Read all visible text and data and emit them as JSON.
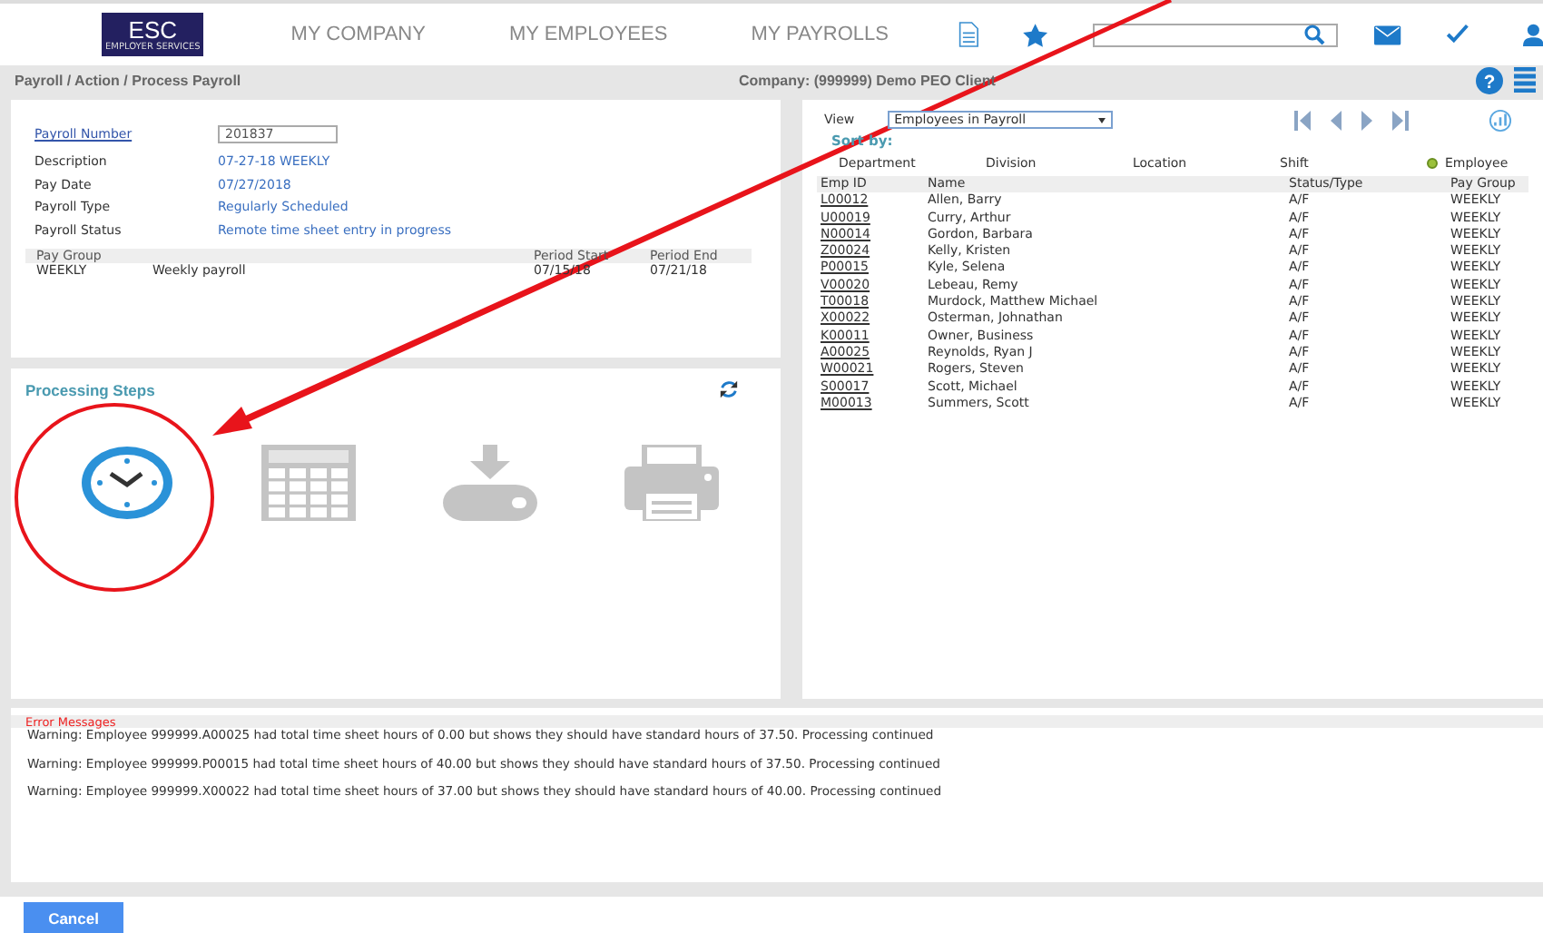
{
  "header": {
    "logo": "ESC",
    "logo_sub": "EMPLOYER SERVICES",
    "nav": [
      "MY COMPANY",
      "MY EMPLOYEES",
      "MY PAYROLLS"
    ]
  },
  "help": "?",
  "breadcrumb": "Payroll / Action / Process Payroll",
  "company": "Company: (999999) Demo PEO Client",
  "payroll": {
    "number_label": "Payroll Number",
    "number": "201837",
    "fields": [
      {
        "label": "Description",
        "value": "07-27-18 WEEKLY"
      },
      {
        "label": "Pay Date",
        "value": "07/27/2018"
      },
      {
        "label": "Payroll Type",
        "value": "Regularly Scheduled"
      },
      {
        "label": "Payroll Status",
        "value": "Remote time sheet entry in progress"
      }
    ],
    "group_columns": [
      "Pay Group",
      "",
      "Period Start",
      "Period End"
    ],
    "group_rows": [
      [
        "WEEKLY",
        "Weekly payroll",
        "07/15/18",
        "07/21/18"
      ]
    ]
  },
  "processing": {
    "title": "Processing Steps",
    "steps": [
      {
        "kind": "clock",
        "active": true
      },
      {
        "kind": "grid",
        "active": false
      },
      {
        "kind": "download",
        "active": false
      },
      {
        "kind": "printer",
        "active": false
      }
    ]
  },
  "employees": {
    "view_label": "View",
    "view": "Employees in Payroll",
    "sort_label": "Sort by:",
    "sort_options": [
      {
        "label": "Department",
        "selected": false
      },
      {
        "label": "Division",
        "selected": false
      },
      {
        "label": "Location",
        "selected": false
      },
      {
        "label": "Shift",
        "selected": false
      },
      {
        "label": "Employee",
        "selected": true
      }
    ],
    "columns": [
      "Emp ID",
      "Name",
      "Status/Type",
      "Pay Group"
    ],
    "rows": [
      [
        "L00012",
        "Allen, Barry",
        "A/F",
        "WEEKLY"
      ],
      [
        "U00019",
        "Curry, Arthur",
        "A/F",
        "WEEKLY"
      ],
      [
        "N00014",
        "Gordon, Barbara",
        "A/F",
        "WEEKLY"
      ],
      [
        "Z00024",
        "Kelly, Kristen",
        "A/F",
        "WEEKLY"
      ],
      [
        "P00015",
        "Kyle, Selena",
        "A/F",
        "WEEKLY"
      ],
      [
        "V00020",
        "Lebeau, Remy",
        "A/F",
        "WEEKLY"
      ],
      [
        "T00018",
        "Murdock, Matthew Michael",
        "A/F",
        "WEEKLY"
      ],
      [
        "X00022",
        "Osterman, Johnathan",
        "A/F",
        "WEEKLY"
      ],
      [
        "K00011",
        "Owner, Business",
        "A/F",
        "WEEKLY"
      ],
      [
        "A00025",
        "Reynolds, Ryan J",
        "A/F",
        "WEEKLY"
      ],
      [
        "W00021",
        "Rogers, Steven",
        "A/F",
        "WEEKLY"
      ],
      [
        "S00017",
        "Scott, Michael",
        "A/F",
        "WEEKLY"
      ],
      [
        "M00013",
        "Summers, Scott",
        "A/F",
        "WEEKLY"
      ]
    ]
  },
  "errors": {
    "title": "Error Messages",
    "messages": [
      "Warning: Employee 999999.A00025 had total time sheet hours of 0.00 but shows they should have standard hours of 37.50. Processing continued",
      "Warning: Employee 999999.P00015 had total time sheet hours of 40.00 but shows they should have standard hours of 37.50. Processing continued",
      "Warning: Employee 999999.X00022 had total time sheet hours of 37.00 but shows they should have standard hours of 40.00. Processing continued"
    ]
  },
  "cancel": "Cancel"
}
